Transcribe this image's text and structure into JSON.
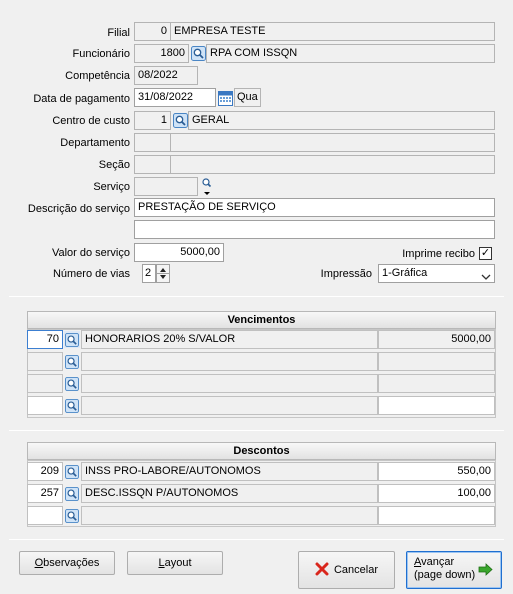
{
  "form": {
    "filial": {
      "label": "Filial",
      "code": "0",
      "name": "EMPRESA TESTE"
    },
    "funcionario": {
      "label": "Funcionário",
      "code": "1800",
      "name": "RPA COM ISSQN"
    },
    "competencia": {
      "label": "Competência",
      "value": "08/2022"
    },
    "data_pagamento": {
      "label": "Data de pagamento",
      "value": "31/08/2022",
      "weekday": "Qua"
    },
    "centro_custo": {
      "label": "Centro de custo",
      "code": "1",
      "name": "GERAL"
    },
    "departamento": {
      "label": "Departamento",
      "code": "",
      "name": ""
    },
    "secao": {
      "label": "Seção",
      "code": "",
      "name": ""
    },
    "servico": {
      "label": "Serviço",
      "code": ""
    },
    "descricao": {
      "label": "Descrição do serviço",
      "line1": "PRESTAÇÃO DE SERVIÇO",
      "line2": ""
    },
    "valor": {
      "label": "Valor do serviço",
      "value": "5000,00"
    },
    "imprime_recibo": {
      "label": "Imprime recibo",
      "checked": true,
      "mark": "✓"
    },
    "vias": {
      "label": "Número de vias",
      "value": "2"
    },
    "impressao": {
      "label": "Impressão",
      "value": "1-Gráfica"
    }
  },
  "vencimentos": {
    "title": "Vencimentos",
    "rows": [
      {
        "code": "70",
        "desc": "HONORARIOS 20% S/VALOR",
        "value": "5000,00"
      },
      {
        "code": "",
        "desc": "",
        "value": ""
      },
      {
        "code": "",
        "desc": "",
        "value": ""
      },
      {
        "code": "",
        "desc": "",
        "value": ""
      }
    ]
  },
  "descontos": {
    "title": "Descontos",
    "rows": [
      {
        "code": "209",
        "desc": "INSS PRO-LABORE/AUTONOMOS",
        "value": "550,00"
      },
      {
        "code": "257",
        "desc": "DESC.ISSQN P/AUTONOMOS",
        "value": "100,00"
      },
      {
        "code": "",
        "desc": "",
        "value": ""
      }
    ]
  },
  "buttons": {
    "observacoes": {
      "accel": "O",
      "rest": "bservações"
    },
    "layout": {
      "accel": "L",
      "rest": "ayout"
    },
    "cancelar": "Cancelar",
    "avancar": {
      "accel": "A",
      "rest": "vançar",
      "line2": "(page down)"
    }
  },
  "colors": {
    "selection": "#3c7fd1",
    "cancel_icon": "#d9261c",
    "next_icon": "#3aa62c"
  },
  "icons": [
    "search-icon",
    "calendar-icon",
    "spin-up-icon",
    "spin-down-icon",
    "chevron-down-icon",
    "cancel-x-icon",
    "arrow-right-icon"
  ]
}
